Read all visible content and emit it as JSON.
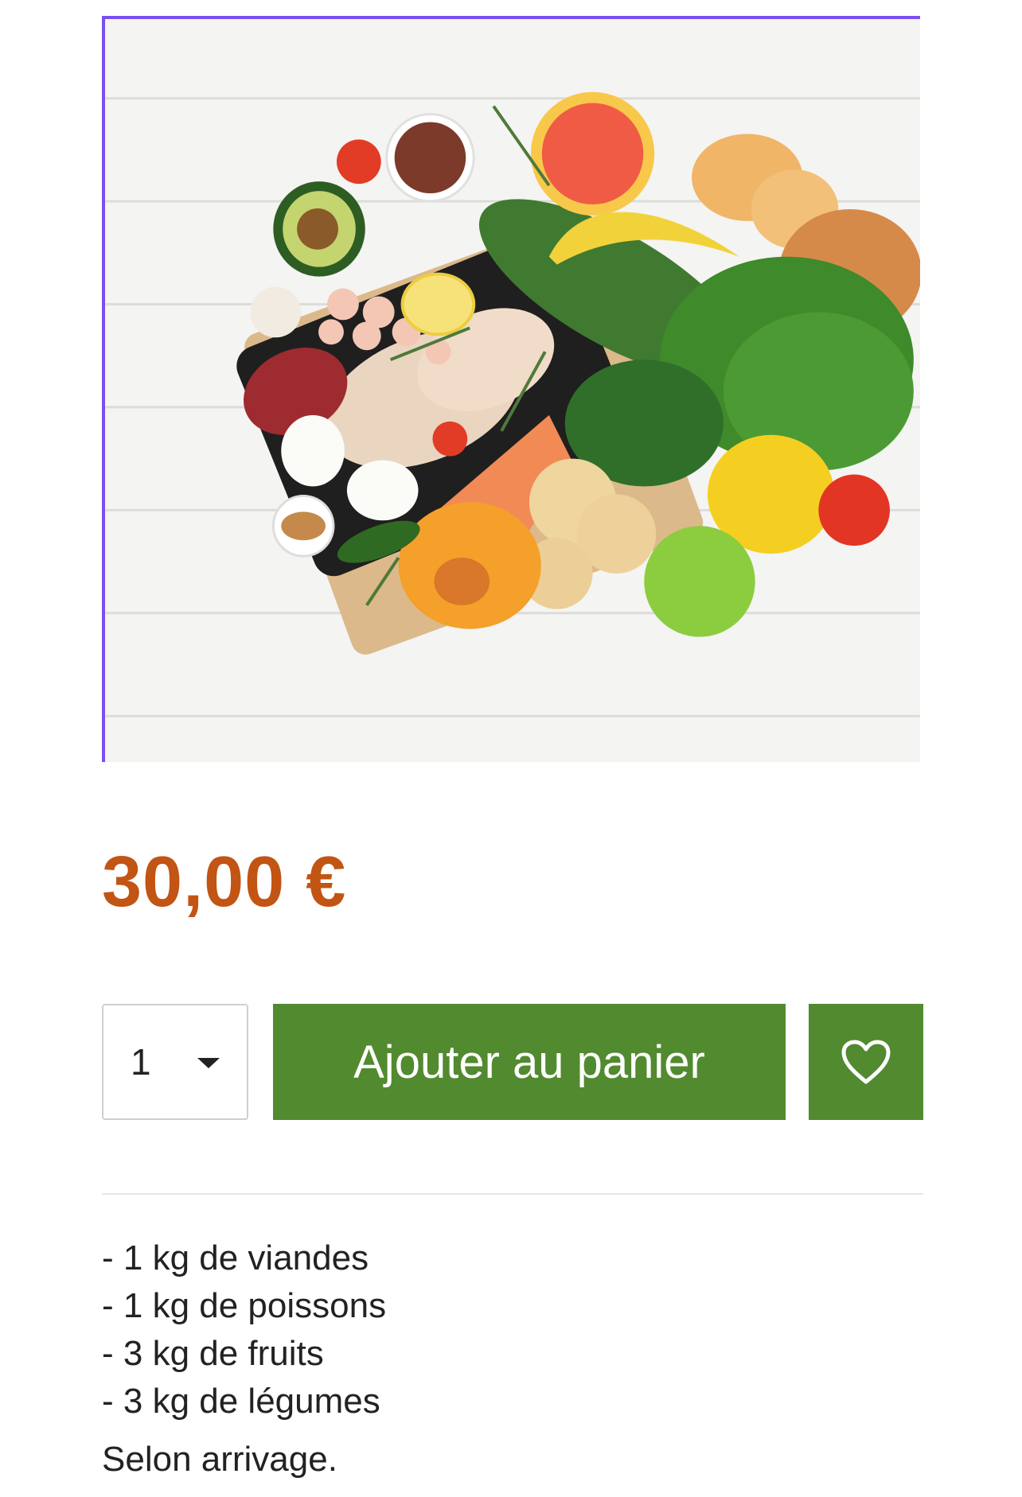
{
  "product": {
    "image_alt": "Assortiment de viandes, poissons, fruits et légumes",
    "price": "30,00 €",
    "quantity": "1",
    "add_to_cart_label": "Ajouter au panier",
    "wishlist_icon": "heart-icon",
    "description_lines": [
      "- 1 kg de viandes",
      "- 1 kg de poissons",
      "- 3 kg de fruits",
      "- 3 kg de légumes"
    ],
    "note": "Selon arrivage."
  },
  "colors": {
    "price": "#c25414",
    "button": "#528a2f",
    "image_border": "#7a4ff0"
  }
}
